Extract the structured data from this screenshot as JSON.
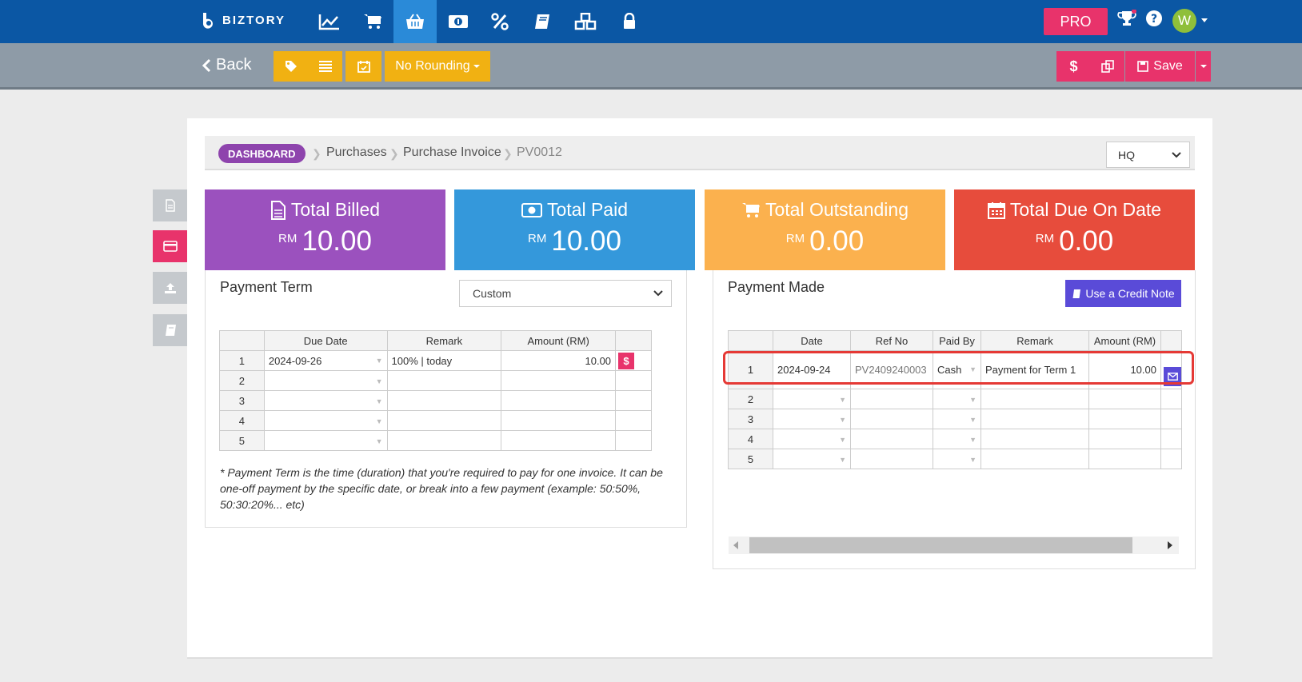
{
  "app": {
    "logo_text": "BIZTORY"
  },
  "topnav": {
    "icons": [
      "chart-line-icon",
      "cart-icon",
      "basket-icon",
      "money-icon",
      "percent-icon",
      "book-icon",
      "cubes-icon",
      "lock-icon"
    ],
    "active": "basket-icon",
    "pro_label": "PRO",
    "avatar_initial": "W"
  },
  "toolbar": {
    "back_label": "Back",
    "rounding_label": "No Rounding",
    "save_label": "Save"
  },
  "breadcrumb": {
    "dashboard": "DASHBOARD",
    "items": [
      "Purchases",
      "Purchase Invoice",
      "PV0012"
    ]
  },
  "branch_select": {
    "value": "HQ"
  },
  "cards": [
    {
      "title": "Total Billed",
      "currency": "RM",
      "value": "10.00",
      "color": "#9b51be",
      "icon": "file-icon"
    },
    {
      "title": "Total Paid",
      "currency": "RM",
      "value": "10.00",
      "color": "#3498db",
      "icon": "money-icon"
    },
    {
      "title": "Total Outstanding",
      "currency": "RM",
      "value": "0.00",
      "color": "#fbb14e",
      "icon": "cart-icon"
    },
    {
      "title": "Total Due On Date",
      "currency": "RM",
      "value": "0.00",
      "color": "#e74c3c",
      "icon": "calendar-icon"
    }
  ],
  "payment_term": {
    "title": "Payment Term",
    "term_select": "Custom",
    "columns": [
      "Due Date",
      "Remark",
      "Amount (RM)"
    ],
    "rows": [
      {
        "n": "1",
        "due": "2024-09-26",
        "remark": "100% |  today",
        "amount": "10.00"
      },
      {
        "n": "2",
        "due": "",
        "remark": "",
        "amount": ""
      },
      {
        "n": "3",
        "due": "",
        "remark": "",
        "amount": ""
      },
      {
        "n": "4",
        "due": "",
        "remark": "",
        "amount": ""
      },
      {
        "n": "5",
        "due": "",
        "remark": "",
        "amount": ""
      }
    ],
    "note": "* Payment Term is the time (duration) that you're required to pay for one invoice. It can be one-off payment by the specific date, or break into a few payment (example: 50:50%, 50:30:20%... etc)"
  },
  "payment_made": {
    "title": "Payment Made",
    "credit_button": "Use a Credit Note",
    "columns": [
      "Date",
      "Ref No",
      "Paid By",
      "Remark",
      "Amount (RM)"
    ],
    "rows": [
      {
        "n": "1",
        "date": "2024-09-24",
        "ref": "PV2409240003",
        "by": "Cash",
        "remark": "Payment for Term 1",
        "amount": "10.00"
      },
      {
        "n": "2",
        "date": "",
        "ref": "",
        "by": "",
        "remark": "",
        "amount": ""
      },
      {
        "n": "3",
        "date": "",
        "ref": "",
        "by": "",
        "remark": "",
        "amount": ""
      },
      {
        "n": "4",
        "date": "",
        "ref": "",
        "by": "",
        "remark": "",
        "amount": ""
      },
      {
        "n": "5",
        "date": "",
        "ref": "",
        "by": "",
        "remark": "",
        "amount": ""
      }
    ]
  },
  "colors": {
    "nav": "#0b57a4",
    "toolbar": "#8e9ba7",
    "accent_pink": "#e8336b",
    "accent_yellow": "#f1b112",
    "highlight": "#e53935"
  }
}
